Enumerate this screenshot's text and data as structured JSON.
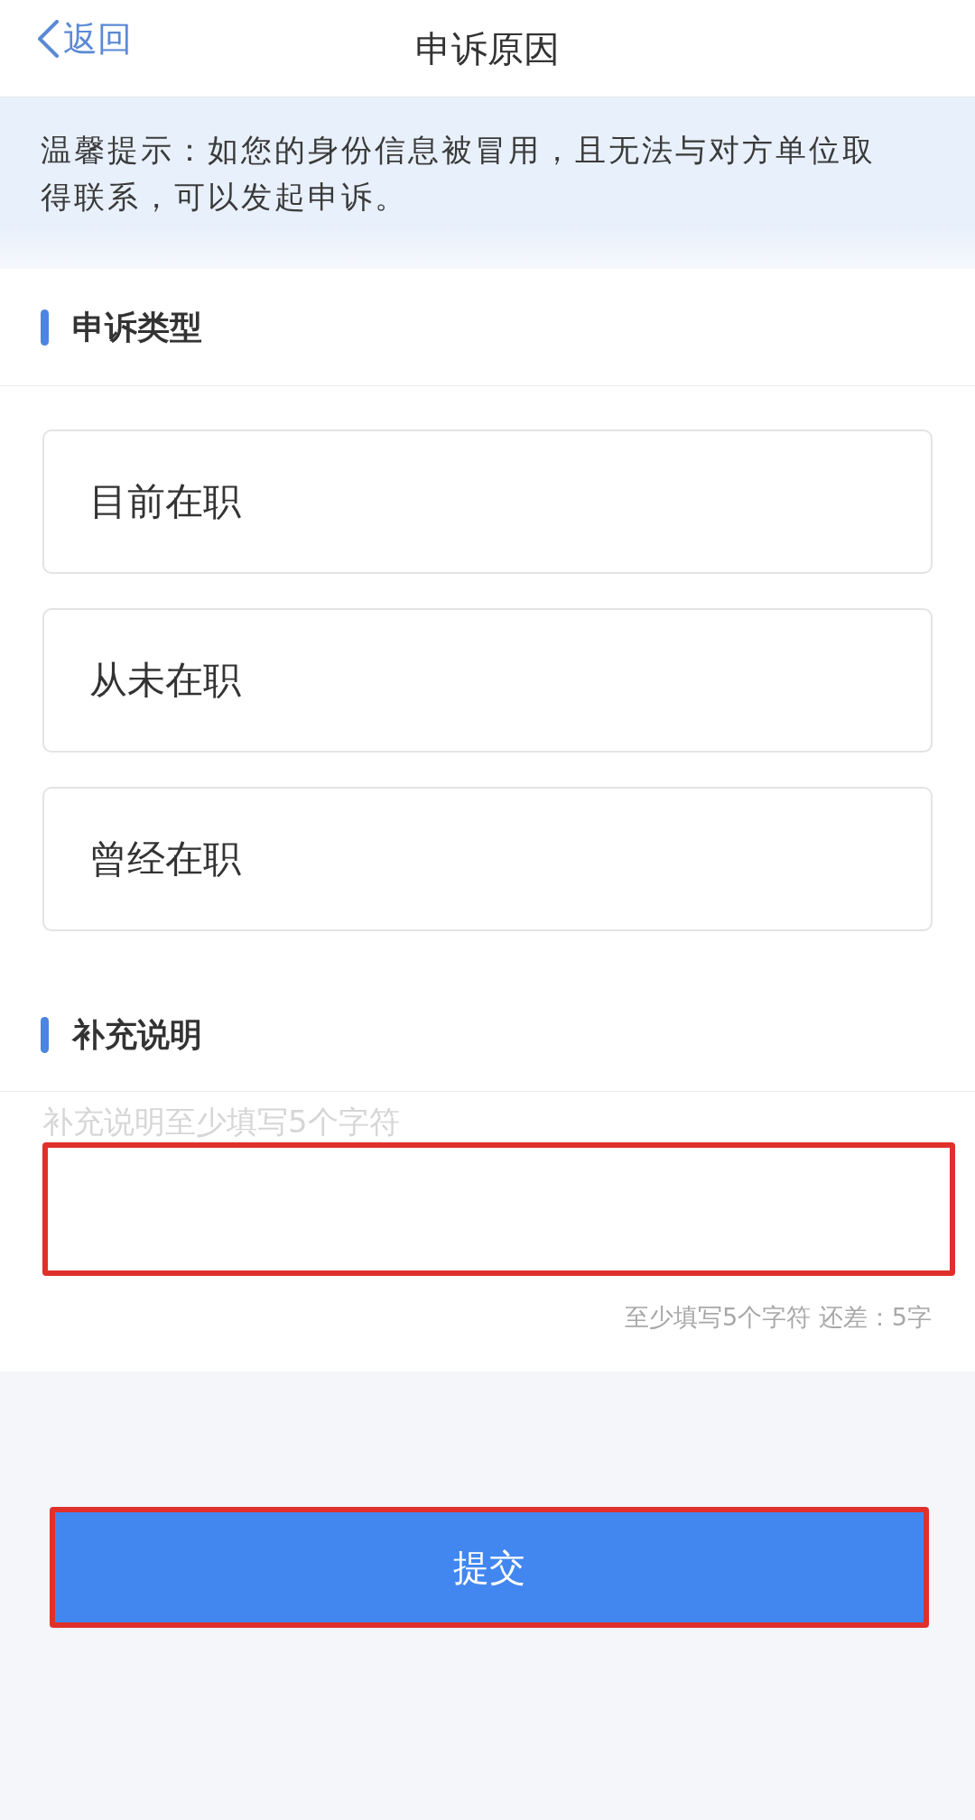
{
  "nav": {
    "back": "返回",
    "title": "申诉原因"
  },
  "notice": "温馨提示：如您的身份信息被冒用，且无法与对方单位取得联系，可以发起申诉。",
  "complaint_type": {
    "heading": "申诉类型",
    "options": [
      {
        "label": "目前在职",
        "selected": false
      },
      {
        "label": "从未在职",
        "selected": false
      },
      {
        "label": "曾经在职",
        "selected": false
      }
    ]
  },
  "supplement": {
    "heading": "补充说明",
    "placeholder": "补充说明至少填写5个字符",
    "highlighted": true,
    "counter": "至少填写5个字符 还差：5字"
  },
  "submit_button": {
    "label": "提交",
    "highlighted": true
  }
}
